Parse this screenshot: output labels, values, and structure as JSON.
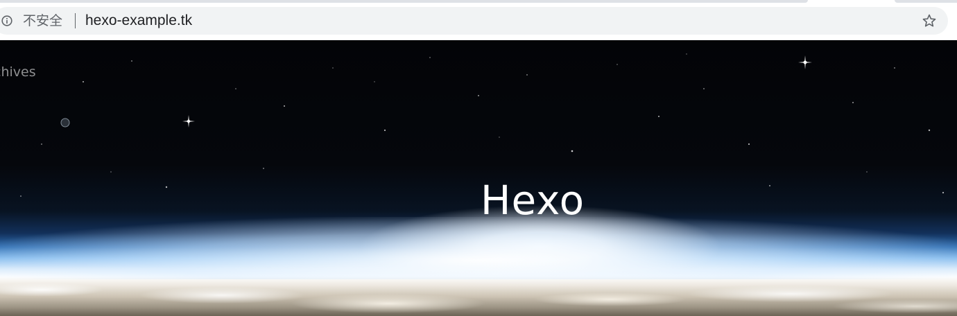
{
  "browser": {
    "security_label": "不安全",
    "url": "hexo-example.tk",
    "icons": {
      "info": "info-circle-icon",
      "bookmark": "star-outline-icon"
    }
  },
  "site": {
    "nav": {
      "archives_label": "chives"
    },
    "title": "Hexo"
  },
  "colors": {
    "omnibox_bg": "#f1f3f4",
    "sky_top": "#030407",
    "horizon_blue": "#2f6fb4",
    "title_text": "#ffffff"
  }
}
